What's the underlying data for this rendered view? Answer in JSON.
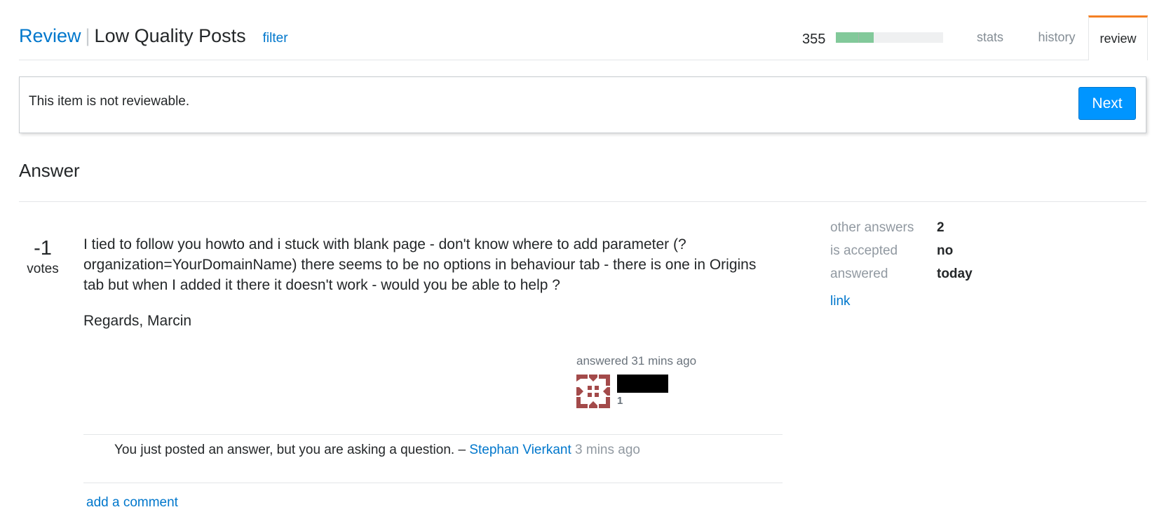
{
  "header": {
    "review_link": "Review",
    "separator": "|",
    "queue_title": "Low Quality Posts",
    "filter_label": "filter",
    "review_count": "355",
    "progress_percent": 35,
    "progress_marker_percent": 21,
    "tabs": [
      {
        "label": "stats",
        "active": false
      },
      {
        "label": "history",
        "active": false
      },
      {
        "label": "review",
        "active": true
      }
    ]
  },
  "notice": {
    "message": "This item is not reviewable.",
    "next_label": "Next"
  },
  "section": {
    "title": "Answer"
  },
  "post": {
    "vote_count": "-1",
    "vote_label": "votes",
    "paragraphs": [
      "I tied to follow you howto and i stuck with blank page - don't know where to add parameter (?organization=YourDomainName) there seems to be no options in behaviour tab - there is one in Origins tab but when I added it there it doesn't work - would you be able to help ?",
      "Regards, Marcin"
    ],
    "signature": {
      "action": "answered 31 mins ago",
      "avatar_icon": "identicon",
      "user_name_redacted": true,
      "reputation": "1"
    }
  },
  "comments": [
    {
      "text": "You just posted an answer, but you are asking a question. – ",
      "user": "Stephan Vierkant",
      "time": "3 mins ago"
    }
  ],
  "add_comment_label": "add a comment",
  "sidebar": {
    "stats": [
      {
        "label": "other answers",
        "value": "2"
      },
      {
        "label": "is accepted",
        "value": "no"
      },
      {
        "label": "answered",
        "value": "today"
      }
    ],
    "link_label": "link"
  },
  "colors": {
    "link": "#0077cc",
    "accent_tab": "#f48024",
    "primary_button": "#0095ff",
    "progress_fill": "#82c99a",
    "avatar": "#a34a4a"
  }
}
